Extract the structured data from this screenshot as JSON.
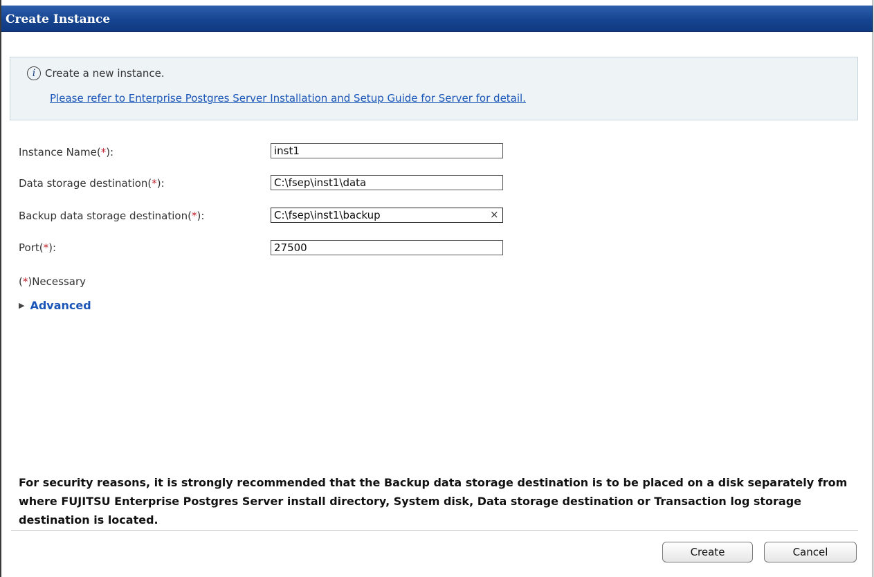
{
  "window": {
    "title": "Create Instance"
  },
  "info": {
    "icon": "info-icon",
    "message": "Create a new instance.",
    "link_text": "Please refer to Enterprise Postgres Server Installation and Setup Guide for Server for detail."
  },
  "form": {
    "instance_name": {
      "label": "Instance Name(",
      "req": "*",
      "suffix": "):",
      "value": "inst1"
    },
    "data_storage": {
      "label": "Data storage destination(",
      "req": "*",
      "suffix": "):",
      "value": "C:\\fsep\\inst1\\data"
    },
    "backup_storage": {
      "label": "Backup data storage destination(",
      "req": "*",
      "suffix": "):",
      "value": "C:\\fsep\\inst1\\backup"
    },
    "port": {
      "label": "Port(",
      "req": "*",
      "suffix": "):",
      "value": "27500"
    },
    "clear_symbol": "×"
  },
  "necessary": {
    "open": "(",
    "req": "*",
    "text": ")Necessary"
  },
  "advanced": {
    "arrow": "▶",
    "label": "Advanced"
  },
  "warning": "For security reasons, it is strongly recommended that the Backup data storage destination is to be placed on a disk separately from where FUJITSU Enterprise Postgres Server install directory, System disk, Data storage destination or Transaction log storage destination is located.",
  "buttons": {
    "create": "Create",
    "cancel": "Cancel"
  },
  "colors": {
    "title_bar": "#174490",
    "required": "#c0202a",
    "link": "#1a56b8"
  }
}
